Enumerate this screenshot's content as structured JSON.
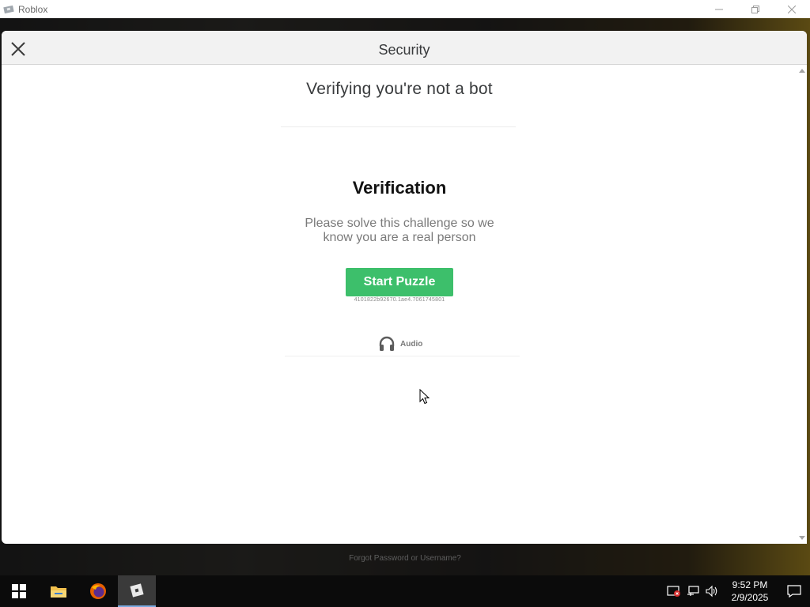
{
  "window": {
    "title": "Roblox",
    "controls": [
      "minimize-icon",
      "restore-icon",
      "close-icon"
    ]
  },
  "background": {
    "forgot_link": "Forgot Password or Username?"
  },
  "modal": {
    "title": "Security",
    "heading": "Verifying you're not a bot",
    "challenge_title": "Verification",
    "challenge_desc_line1": "Please solve this challenge so we",
    "challenge_desc_line2": "know you are a real person",
    "start_button": "Start Puzzle",
    "session_id": "4101822b92670.1ae4.7061745801",
    "audio_label": "Audio"
  },
  "colors": {
    "accent_green": "#3dbf6b",
    "taskbar": "#0b0b0b"
  },
  "taskbar": {
    "items": [
      {
        "name": "start-button",
        "icon": "windows-icon"
      },
      {
        "name": "file-explorer-button",
        "icon": "folder-icon"
      },
      {
        "name": "firefox-button",
        "icon": "firefox-icon"
      },
      {
        "name": "roblox-button",
        "icon": "roblox-icon",
        "active": true
      }
    ],
    "tray_icons": [
      "security-alert-icon",
      "network-icon",
      "volume-icon"
    ],
    "time": "9:52 PM",
    "date": "2/9/2025"
  }
}
